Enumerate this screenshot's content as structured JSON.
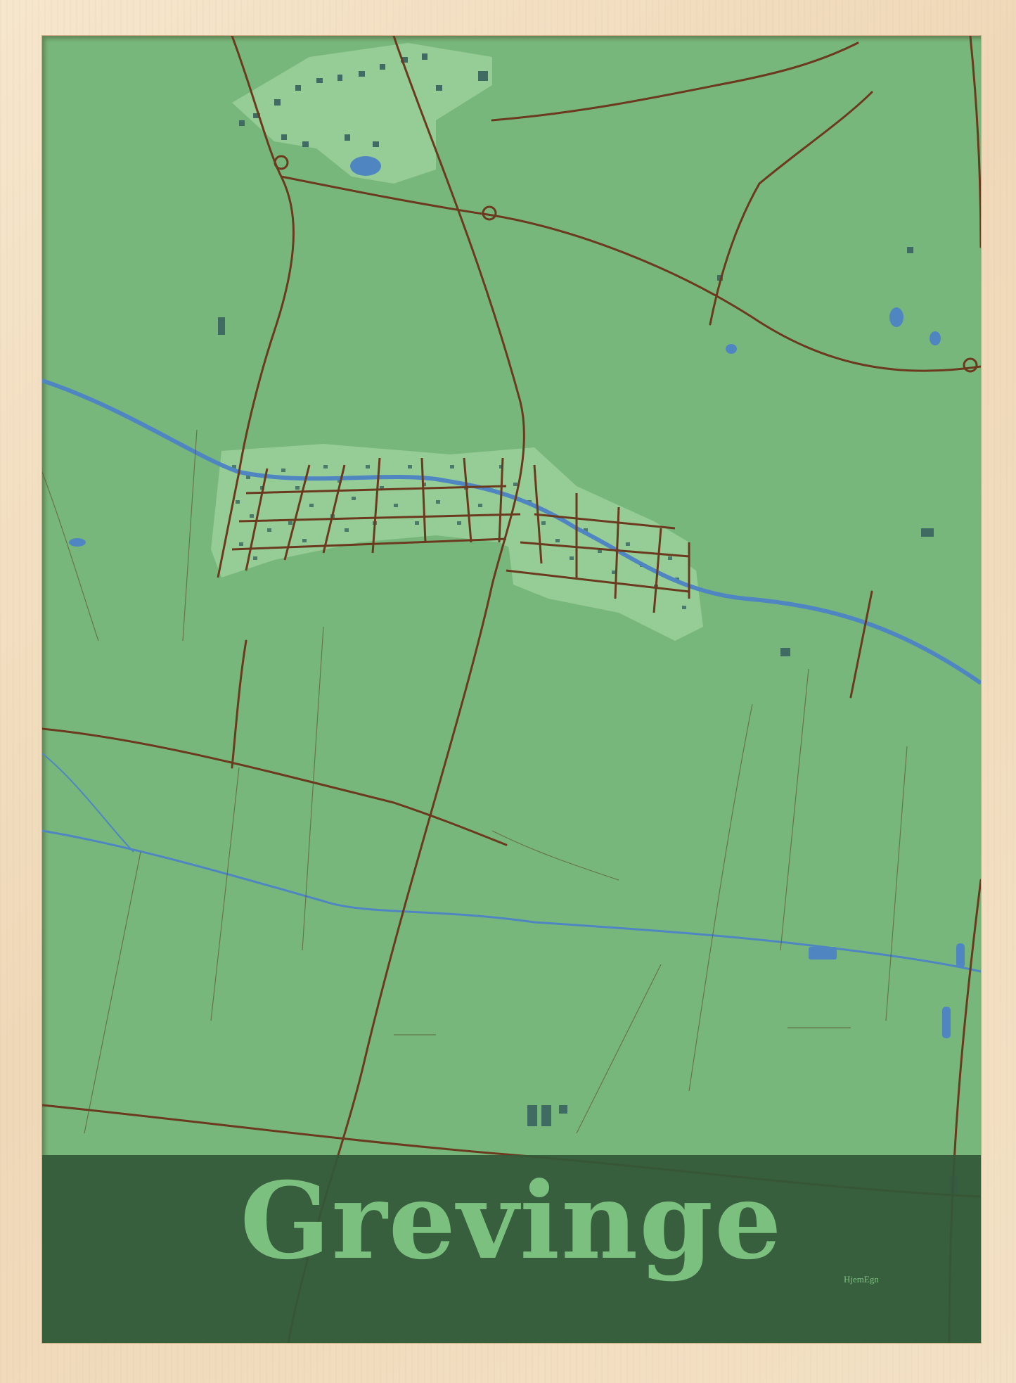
{
  "poster": {
    "title": "Grevinge",
    "brand": "HjemEgn"
  },
  "colors": {
    "land": "#78b77b",
    "urban_area": "#96cc96",
    "road": "#6b3a1e",
    "water": "#4f86c2",
    "building": "#3f6b63",
    "banner": "#345838",
    "frame": "#f0dcbf"
  }
}
